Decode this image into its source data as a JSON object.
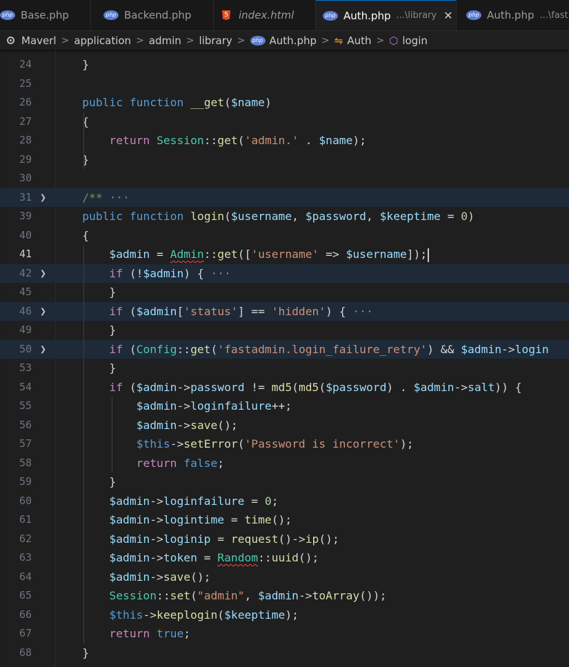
{
  "tabs": [
    {
      "label": "Base.php",
      "icon": "php-icon"
    },
    {
      "label": "Backend.php",
      "icon": "php-icon"
    },
    {
      "label": "index.html",
      "icon": "html5-icon"
    },
    {
      "label": "Auth.php",
      "desc": "...\\library",
      "icon": "php-icon",
      "active": true,
      "close": "✕"
    },
    {
      "label": "Auth.php",
      "desc": "...\\fast",
      "icon": "php-icon"
    }
  ],
  "breadcrumb": {
    "items": [
      "Maverl",
      "application",
      "admin",
      "library",
      "Auth.php",
      "Auth",
      "login"
    ]
  },
  "editor": {
    "current_line": 41,
    "lines": [
      {
        "n": "24",
        "code": "    }"
      },
      {
        "n": "25",
        "code": ""
      },
      {
        "n": "26",
        "code": "    public function __get($name)"
      },
      {
        "n": "27",
        "code": "    {"
      },
      {
        "n": "28",
        "code": "        return Session::get('admin.' . $name);"
      },
      {
        "n": "29",
        "code": "    }"
      },
      {
        "n": "30",
        "code": ""
      },
      {
        "n": "31",
        "code": "    /** ...",
        "folded": true
      },
      {
        "n": "39",
        "code": "    public function login($username, $password, $keeptime = 0)"
      },
      {
        "n": "40",
        "code": "    {"
      },
      {
        "n": "41",
        "code": "        $admin = Admin::get(['username' => $username]);"
      },
      {
        "n": "42",
        "code": "        if (!$admin) { ...",
        "folded": true
      },
      {
        "n": "45",
        "code": "        }"
      },
      {
        "n": "46",
        "code": "        if ($admin['status'] == 'hidden') { ...",
        "folded": true
      },
      {
        "n": "49",
        "code": "        }"
      },
      {
        "n": "50",
        "code": "        if (Config::get('fastadmin.login_failure_retry') && $admin->login",
        "folded": true
      },
      {
        "n": "53",
        "code": "        }"
      },
      {
        "n": "54",
        "code": "        if ($admin->password != md5(md5($password) . $admin->salt)) {"
      },
      {
        "n": "55",
        "code": "            $admin->loginfailure++;"
      },
      {
        "n": "56",
        "code": "            $admin->save();"
      },
      {
        "n": "57",
        "code": "            $this->setError('Password is incorrect');"
      },
      {
        "n": "58",
        "code": "            return false;"
      },
      {
        "n": "59",
        "code": "        }"
      },
      {
        "n": "60",
        "code": "        $admin->loginfailure = 0;"
      },
      {
        "n": "61",
        "code": "        $admin->logintime = time();"
      },
      {
        "n": "62",
        "code": "        $admin->loginip = request()->ip();"
      },
      {
        "n": "63",
        "code": "        $admin->token = Random::uuid();"
      },
      {
        "n": "64",
        "code": "        $admin->save();"
      },
      {
        "n": "65",
        "code": "        Session::set(\"admin\", $admin->toArray());"
      },
      {
        "n": "66",
        "code": "        $this->keeplogin($keeptime);"
      },
      {
        "n": "67",
        "code": "        return true;"
      },
      {
        "n": "68",
        "code": "    }"
      }
    ]
  },
  "colors": {
    "keyword": "#569cd6",
    "control": "#c586c0",
    "function": "#dcdcaa",
    "variable": "#9cdcfe",
    "string": "#ce9178",
    "number": "#b5cea8",
    "class": "#4ec9b0",
    "comment": "#6a9955",
    "accent": "#0078d4",
    "background": "#1f1f1f"
  }
}
